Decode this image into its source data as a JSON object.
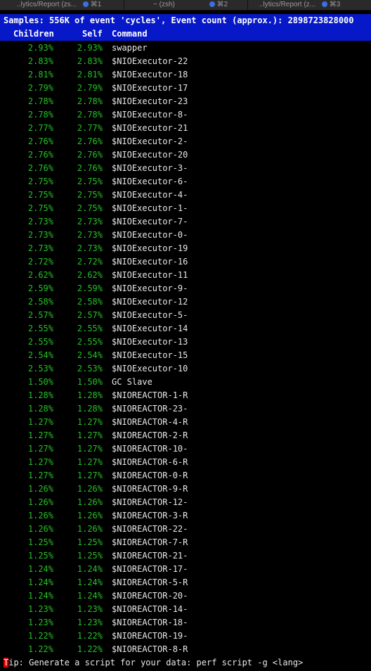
{
  "tabs": [
    {
      "label": "..lytics/Report (zs...",
      "shortcut": "⌘1"
    },
    {
      "label": "~ (zsh)",
      "shortcut": "⌘2"
    },
    {
      "label": "..lytics/Report (z...",
      "shortcut": "⌘3"
    }
  ],
  "header": {
    "summary": "Samples: 556K of event 'cycles', Event count (approx.): 2898723828000",
    "col_children": "Children",
    "col_self": "Self",
    "col_command": "Command"
  },
  "rows": [
    {
      "children": "2.93%",
      "self": "2.93%",
      "command": "swapper"
    },
    {
      "children": "2.83%",
      "self": "2.83%",
      "command": "$NIOExecutor-22"
    },
    {
      "children": "2.81%",
      "self": "2.81%",
      "command": "$NIOExecutor-18"
    },
    {
      "children": "2.79%",
      "self": "2.79%",
      "command": "$NIOExecutor-17"
    },
    {
      "children": "2.78%",
      "self": "2.78%",
      "command": "$NIOExecutor-23"
    },
    {
      "children": "2.78%",
      "self": "2.78%",
      "command": "$NIOExecutor-8-"
    },
    {
      "children": "2.77%",
      "self": "2.77%",
      "command": "$NIOExecutor-21"
    },
    {
      "children": "2.76%",
      "self": "2.76%",
      "command": "$NIOExecutor-2-"
    },
    {
      "children": "2.76%",
      "self": "2.76%",
      "command": "$NIOExecutor-20"
    },
    {
      "children": "2.76%",
      "self": "2.76%",
      "command": "$NIOExecutor-3-"
    },
    {
      "children": "2.75%",
      "self": "2.75%",
      "command": "$NIOExecutor-6-"
    },
    {
      "children": "2.75%",
      "self": "2.75%",
      "command": "$NIOExecutor-4-"
    },
    {
      "children": "2.75%",
      "self": "2.75%",
      "command": "$NIOExecutor-1-"
    },
    {
      "children": "2.73%",
      "self": "2.73%",
      "command": "$NIOExecutor-7-"
    },
    {
      "children": "2.73%",
      "self": "2.73%",
      "command": "$NIOExecutor-0-"
    },
    {
      "children": "2.73%",
      "self": "2.73%",
      "command": "$NIOExecutor-19"
    },
    {
      "children": "2.72%",
      "self": "2.72%",
      "command": "$NIOExecutor-16"
    },
    {
      "children": "2.62%",
      "self": "2.62%",
      "command": "$NIOExecutor-11"
    },
    {
      "children": "2.59%",
      "self": "2.59%",
      "command": "$NIOExecutor-9-"
    },
    {
      "children": "2.58%",
      "self": "2.58%",
      "command": "$NIOExecutor-12"
    },
    {
      "children": "2.57%",
      "self": "2.57%",
      "command": "$NIOExecutor-5-"
    },
    {
      "children": "2.55%",
      "self": "2.55%",
      "command": "$NIOExecutor-14"
    },
    {
      "children": "2.55%",
      "self": "2.55%",
      "command": "$NIOExecutor-13"
    },
    {
      "children": "2.54%",
      "self": "2.54%",
      "command": "$NIOExecutor-15"
    },
    {
      "children": "2.53%",
      "self": "2.53%",
      "command": "$NIOExecutor-10"
    },
    {
      "children": "1.50%",
      "self": "1.50%",
      "command": "GC Slave"
    },
    {
      "children": "1.28%",
      "self": "1.28%",
      "command": "$NIOREACTOR-1-R"
    },
    {
      "children": "1.28%",
      "self": "1.28%",
      "command": "$NIOREACTOR-23-"
    },
    {
      "children": "1.27%",
      "self": "1.27%",
      "command": "$NIOREACTOR-4-R"
    },
    {
      "children": "1.27%",
      "self": "1.27%",
      "command": "$NIOREACTOR-2-R"
    },
    {
      "children": "1.27%",
      "self": "1.27%",
      "command": "$NIOREACTOR-10-"
    },
    {
      "children": "1.27%",
      "self": "1.27%",
      "command": "$NIOREACTOR-6-R"
    },
    {
      "children": "1.27%",
      "self": "1.27%",
      "command": "$NIOREACTOR-0-R"
    },
    {
      "children": "1.26%",
      "self": "1.26%",
      "command": "$NIOREACTOR-9-R"
    },
    {
      "children": "1.26%",
      "self": "1.26%",
      "command": "$NIOREACTOR-12-"
    },
    {
      "children": "1.26%",
      "self": "1.26%",
      "command": "$NIOREACTOR-3-R"
    },
    {
      "children": "1.26%",
      "self": "1.26%",
      "command": "$NIOREACTOR-22-"
    },
    {
      "children": "1.25%",
      "self": "1.25%",
      "command": "$NIOREACTOR-7-R"
    },
    {
      "children": "1.25%",
      "self": "1.25%",
      "command": "$NIOREACTOR-21-"
    },
    {
      "children": "1.24%",
      "self": "1.24%",
      "command": "$NIOREACTOR-17-"
    },
    {
      "children": "1.24%",
      "self": "1.24%",
      "command": "$NIOREACTOR-5-R"
    },
    {
      "children": "1.24%",
      "self": "1.24%",
      "command": "$NIOREACTOR-20-"
    },
    {
      "children": "1.23%",
      "self": "1.23%",
      "command": "$NIOREACTOR-14-"
    },
    {
      "children": "1.23%",
      "self": "1.23%",
      "command": "$NIOREACTOR-18-"
    },
    {
      "children": "1.22%",
      "self": "1.22%",
      "command": "$NIOREACTOR-19-"
    },
    {
      "children": "1.22%",
      "self": "1.22%",
      "command": "$NIOREACTOR-8-R"
    }
  ],
  "tip": {
    "cursor_char": "T",
    "rest": "ip: Generate a script for your data: perf script -g <lang>"
  },
  "colors": {
    "header_bg": "#0718c8",
    "percent": "#27c127",
    "tab_dot": "#3d6fe0",
    "cursor": "#dd0000"
  }
}
